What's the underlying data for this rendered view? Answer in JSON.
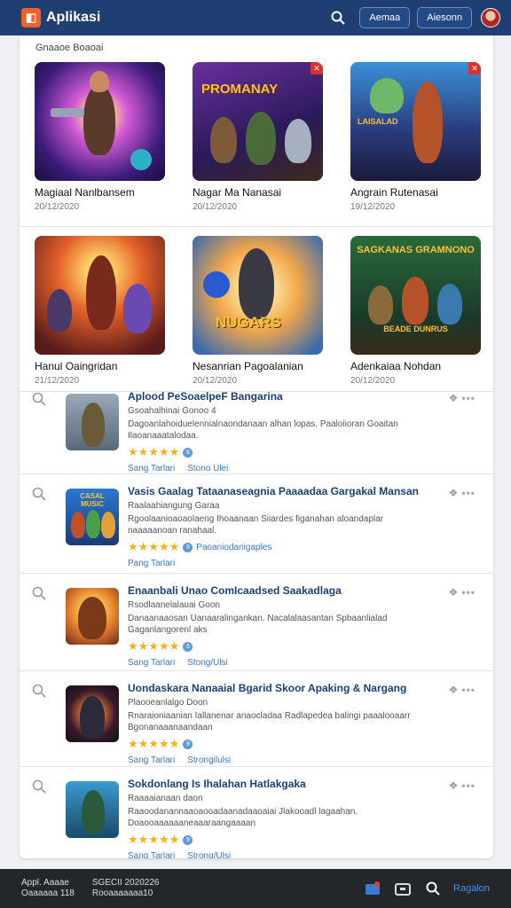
{
  "header": {
    "logo_glyph": "◧",
    "app_title": "Aplikasi",
    "btn_1": "Aemaa",
    "btn_2": "Aiesonn"
  },
  "section_label": "Gnaaoe Boaoai",
  "grid": [
    {
      "title": "Magiaal Nanlbansem",
      "date": "20/12/2020"
    },
    {
      "title": "Nagar Ma Nanasai",
      "date": "20/12/2020"
    },
    {
      "title": "Angrain Rutenasai",
      "date": "19/12/2020"
    },
    {
      "title": "Hanul Oaingridan",
      "date": "21/12/2020"
    },
    {
      "title": "Nesanrian Pagoalanian",
      "date": "20/12/2020"
    },
    {
      "title": "Adenkaiaa Nohdan",
      "date": "20/12/2020"
    }
  ],
  "thumb_text": {
    "t2": "PROMANAY",
    "t4": "LAISALAD",
    "t5": "NUGARS",
    "t6": "SAGKANAS GRAMNONO",
    "t6b": "BEADE DUNRUS",
    "li2": "CASAL MUSIC"
  },
  "list": [
    {
      "title": "Aplood PeSoaelpeF Bangarina",
      "sub": "Gsoahalhinai Gonoo 4",
      "desc": "Dagoanlahoiduelennialnaondanaan alhan lopas. Paaloiioran Goaitan Ilaoanaaatalodaa.",
      "rate_text": "",
      "link_1": "Sang Tarlari",
      "link_2": "Stono Ulei"
    },
    {
      "title": "Vasis Gaalag Tataanaseagnia Paaaadaa Gargakal Mansan",
      "sub": "Raalaahiangung Garaa",
      "desc": "Rgoolaanioaoaolaeng Ihoaanaan Siiardes figanahan aloandaplar naaaaanoan ranahaal.",
      "rate_text": "Paoaniodanigaples",
      "link_1": "Pang Tarlari",
      "link_2": ""
    },
    {
      "title": "Enaanbali Unao ComIcaadsed Saakadlaga",
      "sub": "Rsodlaanelalauai Goon",
      "desc": "Danaanaaosan Uanaaralingankan. Nacalalaasantan Spbaanlialad Gaganlangorenl aks",
      "rate_text": "",
      "link_1": "Sang Tarlari",
      "link_2": "Stong/Ulsi"
    },
    {
      "title": "Uondaskara Nanaaial Bgarid Skoor Apaking & Nargang",
      "sub": "Plaooeanlalgo Doon",
      "desc": "Rnaraioniaanian Iallanenar anaocladaa Radlapedea balingi paaalooaarr Bgonanaaanaandaan",
      "rate_text": "",
      "link_1": "Sang Tarlari",
      "link_2": "Strongilulsi"
    },
    {
      "title": "Sokdonlang Is Ihalahan Hatlakgaka",
      "sub": "Raaaaianaan daon",
      "desc": "Raaoodanannaaoaooadaanadaaoaiai Jlakooadl lagaahan. Doaooaaaaaaneaaaraangaaaan",
      "rate_text": "",
      "link_1": "Sang Tarlari",
      "link_2": "Strong/Ulsi"
    }
  ],
  "footer": {
    "col1_line1": "Appl. Aaaae",
    "col1_line2": "Oaaaaaa 118",
    "col2_line1": "SGECII 2020226",
    "col2_line2": "Rooaaaaaaa10",
    "link": "Ragalon"
  },
  "stars": "★★★★★",
  "rate_dot": "9",
  "badge": "✕",
  "li_menu_glyph": "❖",
  "li_dots": "•••"
}
